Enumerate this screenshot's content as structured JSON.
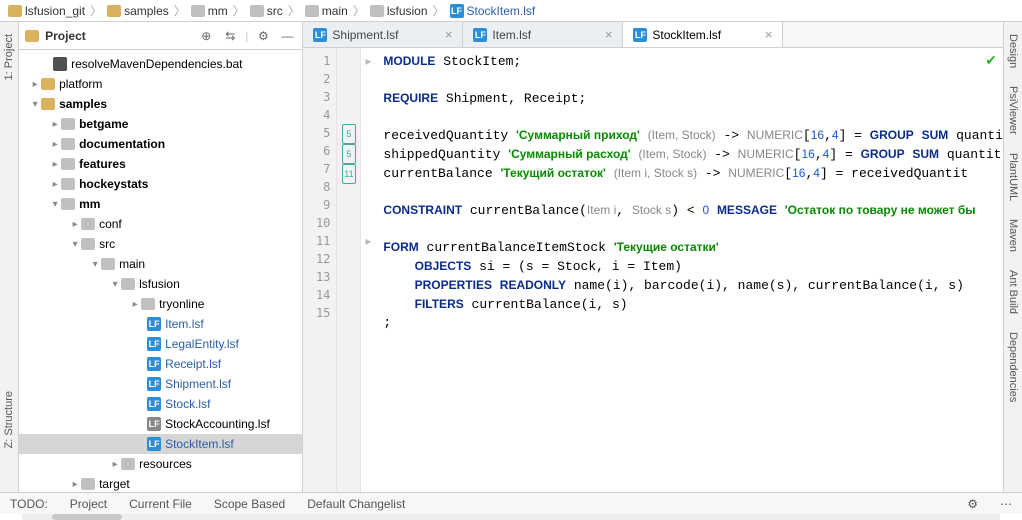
{
  "breadcrumb": [
    {
      "label": "lsfusion_git",
      "icon": "folder"
    },
    {
      "label": "samples",
      "icon": "folder"
    },
    {
      "label": "mm",
      "icon": "folder-gray"
    },
    {
      "label": "src",
      "icon": "folder-gray"
    },
    {
      "label": "main",
      "icon": "folder-gray"
    },
    {
      "label": "lsfusion",
      "icon": "folder-gray"
    },
    {
      "label": "StockItem.lsf",
      "icon": "lsf"
    }
  ],
  "left_tools": {
    "project": "1: Project",
    "structure": "Z: Structure"
  },
  "project": {
    "header": "Project",
    "tree": [
      {
        "indent": 22,
        "tw": "",
        "icon": "bat",
        "label": "resolveMavenDependencies.bat"
      },
      {
        "indent": 10,
        "tw": "▸",
        "icon": "folder",
        "label": "platform"
      },
      {
        "indent": 10,
        "tw": "▾",
        "icon": "folder",
        "label": "samples",
        "bold": true
      },
      {
        "indent": 30,
        "tw": "▸",
        "icon": "folder-gray",
        "label": "betgame",
        "bold": true
      },
      {
        "indent": 30,
        "tw": "▸",
        "icon": "folder-gray",
        "label": "documentation",
        "bold": true
      },
      {
        "indent": 30,
        "tw": "▸",
        "icon": "folder-gray",
        "label": "features",
        "bold": true
      },
      {
        "indent": 30,
        "tw": "▸",
        "icon": "folder-gray",
        "label": "hockeystats",
        "bold": true
      },
      {
        "indent": 30,
        "tw": "▾",
        "icon": "folder-gray",
        "label": "mm",
        "bold": true
      },
      {
        "indent": 50,
        "tw": "▸",
        "icon": "folder-gray",
        "label": "conf"
      },
      {
        "indent": 50,
        "tw": "▾",
        "icon": "folder-gray",
        "label": "src"
      },
      {
        "indent": 70,
        "tw": "▾",
        "icon": "folder-gray",
        "label": "main"
      },
      {
        "indent": 90,
        "tw": "▾",
        "icon": "folder-gray",
        "label": "lsfusion"
      },
      {
        "indent": 110,
        "tw": "▸",
        "icon": "folder-gray",
        "label": "tryonline"
      },
      {
        "indent": 116,
        "tw": "",
        "icon": "lsf",
        "label": "Item.lsf",
        "blue": true
      },
      {
        "indent": 116,
        "tw": "",
        "icon": "lsf",
        "label": "LegalEntity.lsf",
        "blue": true
      },
      {
        "indent": 116,
        "tw": "",
        "icon": "lsf",
        "label": "Receipt.lsf",
        "blue": true
      },
      {
        "indent": 116,
        "tw": "",
        "icon": "lsf",
        "label": "Shipment.lsf",
        "blue": true
      },
      {
        "indent": 116,
        "tw": "",
        "icon": "lsf",
        "label": "Stock.lsf",
        "blue": true
      },
      {
        "indent": 116,
        "tw": "",
        "icon": "lsf-gray",
        "label": "StockAccounting.lsf"
      },
      {
        "indent": 116,
        "tw": "",
        "icon": "lsf",
        "label": "StockItem.lsf",
        "blue": true,
        "selected": true
      },
      {
        "indent": 90,
        "tw": "▸",
        "icon": "folder-gray",
        "label": "resources"
      },
      {
        "indent": 50,
        "tw": "▸",
        "icon": "folder-gray",
        "label": "target"
      }
    ]
  },
  "tabs": [
    {
      "label": "Shipment.lsf",
      "active": false
    },
    {
      "label": "Item.lsf",
      "active": false
    },
    {
      "label": "StockItem.lsf",
      "active": true
    }
  ],
  "code": {
    "line_count": 15,
    "marks": {
      "5": "5",
      "6": "5",
      "7": "11"
    },
    "lines": [
      "<span class='kw'>MODULE</span> StockItem;",
      "",
      "<span class='kw'>REQUIRE</span> Shipment, Receipt;",
      "",
      "receivedQuantity <span class='str'>'Суммарный приход'</span> <span class='ty'>(Item, Stock)</span> -> <span class='ty'>NUMERIC</span>[<span class='num'>16</span>,<span class='num'>4</span>] = <span class='kw'>GROUP</span> <span class='kw'>SUM</span> quanti",
      "shippedQuantity <span class='str'>'Суммарный расход'</span> <span class='ty'>(Item, Stock)</span> -> <span class='ty'>NUMERIC</span>[<span class='num'>16</span>,<span class='num'>4</span>] = <span class='kw'>GROUP</span> <span class='kw'>SUM</span> quantit",
      "currentBalance <span class='str'>'Текущий остаток'</span> <span class='ty'>(Item i, Stock s)</span> -> <span class='ty'>NUMERIC</span>[<span class='num'>16</span>,<span class='num'>4</span>] = receivedQuantit",
      "",
      "<span class='kw'>CONSTRAINT</span> currentBalance(<span class='ty'>Item i</span>, <span class='ty'>Stock s</span>) &lt; <span class='num'>0</span> <span class='kw'>MESSAGE</span> <span class='str'>'Остаток по товару не может бы</span>",
      "",
      "<span class='kw'>FORM</span> currentBalanceItemStock <span class='str'>'Текущие остатки'</span>",
      "    <span class='kw'>OBJECTS</span> si = (s = Stock, i = Item)",
      "    <span class='kw'>PROPERTIES</span> <span class='kw'>READONLY</span> name(i), barcode(i), name(s), currentBalance(i, s)",
      "    <span class='kw'>FILTERS</span> currentBalance(i, s)",
      ";"
    ]
  },
  "right_tools": [
    "Design",
    "PsiViewer",
    "PlantUML",
    "Maven",
    "Ant Build",
    "Dependencies"
  ],
  "statusbar": {
    "items": [
      "TODO:",
      "Project",
      "Current File",
      "Scope Based",
      "Default Changelist"
    ]
  }
}
